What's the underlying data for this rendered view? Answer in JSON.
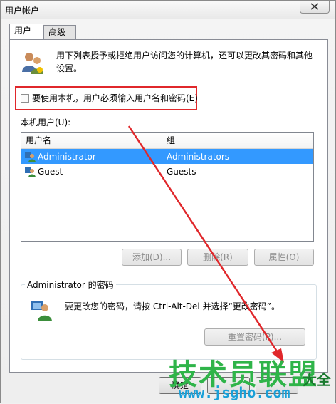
{
  "window": {
    "title": "用户帐户"
  },
  "tabs": [
    {
      "label": "用户"
    },
    {
      "label": "高级"
    }
  ],
  "description": "用下列表授予或拒绝用户访问您的计算机，还可以更改其密码和其他设置。",
  "checkbox": {
    "label": "要使用本机，用户必须输入用户名和密码(E)",
    "checked": false
  },
  "local_users": {
    "label": "本机用户(U):",
    "columns": [
      "用户名",
      "组"
    ],
    "rows": [
      {
        "name": "Administrator",
        "group": "Administrators",
        "selected": true
      },
      {
        "name": "Guest",
        "group": "Guests",
        "selected": false
      }
    ]
  },
  "buttons": {
    "add": "添加(D)...",
    "remove": "删除(R)",
    "properties": "属性(O)"
  },
  "password_group": {
    "title": "Administrator 的密码",
    "text": "要更改您的密码，请按 Ctrl-Alt-Del 并选择“更改密码”。",
    "reset_button": "重置密码(P)..."
  },
  "footer": {
    "ok": "确定"
  },
  "watermark": {
    "text": "技术员联盟",
    "suffix": "大全",
    "url": "www.jsgho.com"
  },
  "colors": {
    "highlight": "#e0272b",
    "selection": "#3399ff",
    "arrow": "#e0272b"
  }
}
